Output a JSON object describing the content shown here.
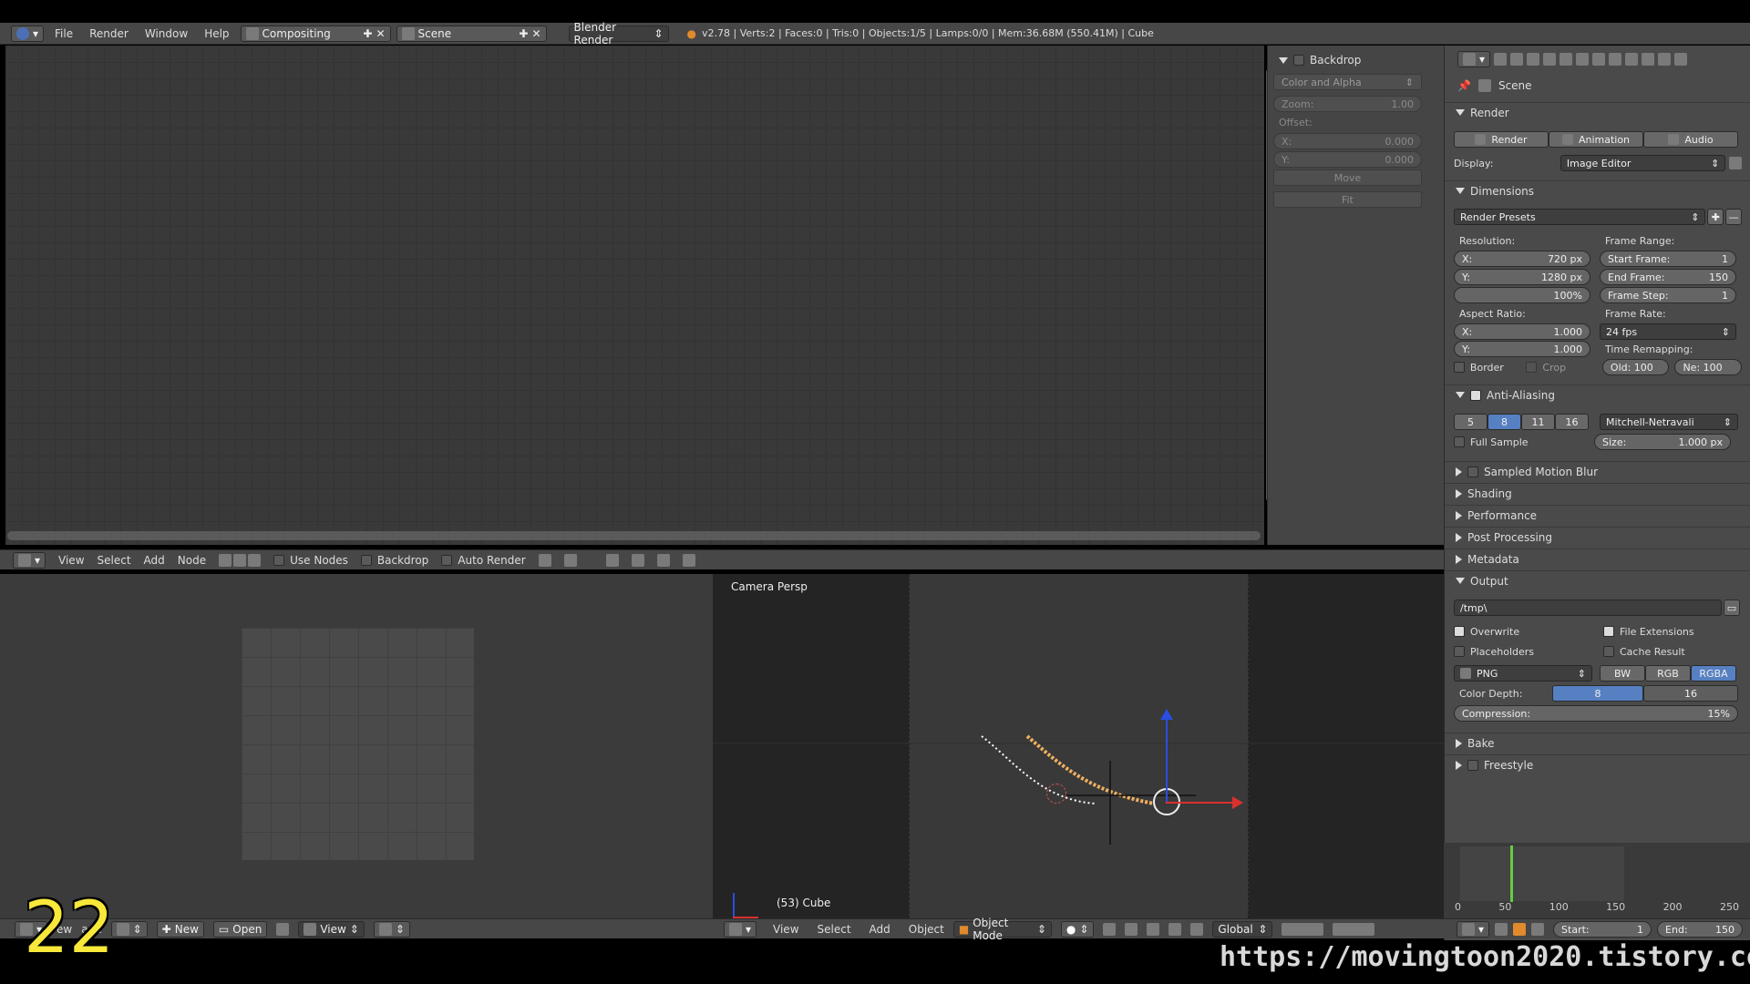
{
  "info_header": {
    "menus": [
      "File",
      "Render",
      "Window",
      "Help"
    ],
    "screen_layout": "Compositing",
    "scene": "Scene",
    "render_engine": "Blender Render",
    "stats": "v2.78 | Verts:2 | Faces:0 | Tris:0 | Objects:1/5 | Lamps:0/0 | Mem:36.68M (550.41M) | Cube"
  },
  "node_sidebar": {
    "title": "Backdrop",
    "channels": "Color and Alpha",
    "zoom_label": "Zoom:",
    "zoom_value": "1.00",
    "offset_label": "Offset:",
    "x_label": "X:",
    "x_value": "0.000",
    "y_label": "Y:",
    "y_value": "0.000",
    "move": "Move",
    "fit": "Fit"
  },
  "node_header": {
    "menus": [
      "View",
      "Select",
      "Add",
      "Node"
    ],
    "use_nodes": "Use Nodes",
    "backdrop": "Backdrop",
    "auto_render": "Auto Render"
  },
  "props": {
    "context": "Scene",
    "render_panel": "Render",
    "render_btn": "Render",
    "animation_btn": "Animation",
    "audio_btn": "Audio",
    "display_label": "Display:",
    "display_value": "Image Editor",
    "dimensions_panel": "Dimensions",
    "render_presets": "Render Presets",
    "resolution_label": "Resolution:",
    "res_x_label": "X:",
    "res_x": "720 px",
    "res_y_label": "Y:",
    "res_y": "1280 px",
    "res_pct": "100%",
    "frame_range_label": "Frame Range:",
    "start_frame_label": "Start Frame:",
    "start_frame": "1",
    "end_frame_label": "End Frame:",
    "end_frame": "150",
    "frame_step_label": "Frame Step:",
    "frame_step": "1",
    "aspect_label": "Aspect Ratio:",
    "asp_x_label": "X:",
    "asp_x": "1.000",
    "asp_y_label": "Y:",
    "asp_y": "1.000",
    "frame_rate_label": "Frame Rate:",
    "frame_rate": "24 fps",
    "time_remap_label": "Time Remapping:",
    "old_label": "Old: 100",
    "new_label": "Ne: 100",
    "border": "Border",
    "crop": "Crop",
    "aa_panel": "Anti-Aliasing",
    "aa_samples": [
      "5",
      "8",
      "11",
      "16"
    ],
    "aa_filter": "Mitchell-Netravali",
    "full_sample": "Full Sample",
    "size_label": "Size:",
    "size_value": "1.000 px",
    "collapsed_panels": [
      "Sampled Motion Blur",
      "Shading",
      "Performance",
      "Post Processing",
      "Metadata"
    ],
    "output_panel": "Output",
    "output_path": "/tmp\\",
    "overwrite": "Overwrite",
    "file_ext": "File Extensions",
    "placeholders": "Placeholders",
    "cache_result": "Cache Result",
    "format": "PNG",
    "color_modes": [
      "BW",
      "RGB",
      "RGBA"
    ],
    "color_depth_label": "Color Depth:",
    "depth_8": "8",
    "depth_16": "16",
    "compression_label": "Compression:",
    "compression_value": "15%",
    "bake": "Bake",
    "freestyle": "Freestyle"
  },
  "view3d": {
    "view_name": "Camera Persp",
    "object_label": "(53) Cube",
    "menus": [
      "View",
      "Select",
      "Add",
      "Object"
    ],
    "mode": "Object Mode",
    "orientation": "Global"
  },
  "image_editor_header": {
    "view_partial": "ew",
    "image_partial": "age",
    "new": "New",
    "open": "Open",
    "view": "View"
  },
  "timeline": {
    "ticks": [
      "0",
      "50",
      "100",
      "150",
      "200",
      "250"
    ],
    "start_label": "Start:",
    "start": "1",
    "end_label": "End:",
    "end": "150",
    "current_frame_fraction": 0.205
  },
  "overlay": {
    "episode_number": "22",
    "watermark": "https://movingtoon2020.tistory.com"
  },
  "colors": {
    "accent_blue": "#5680c2",
    "curve_orange": "#f0b060",
    "axis_red": "#d93030",
    "axis_blue": "#2a4ee0",
    "playhead_green": "#66cc44",
    "episode_yellow": "#f7e83a"
  }
}
